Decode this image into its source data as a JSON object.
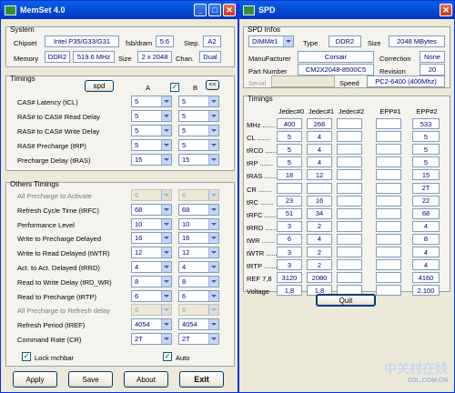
{
  "memset": {
    "title": "MemSet 4.0",
    "system": {
      "legend": "System",
      "chipset_label": "Chipset",
      "chipset_value": "Intel P35/G33/G31",
      "fsb_label": "fsb/dram",
      "fsb_value": "5:6",
      "step_label": "Step.",
      "step_value": "A2",
      "memory_label": "Memory",
      "memory_type": "DDR2",
      "memory_freq": "519.6 MHz",
      "size_label": "Size",
      "size_value": "2 x 2048",
      "chan_label": "Chan.",
      "chan_value": "Dual"
    },
    "timings": {
      "legend": "Timings",
      "spd_button": "spd",
      "col_a": "A",
      "col_b": "B",
      "copy_button": "<<",
      "rows": [
        {
          "label": "CAS# Latency (tCL)",
          "a": "5",
          "b": "5"
        },
        {
          "label": "RAS# to CAS# Read Delay",
          "a": "5",
          "b": "5"
        },
        {
          "label": "RAS# to CAS# Write Delay",
          "a": "5",
          "b": "5"
        },
        {
          "label": "RAS# Precharge (tRP)",
          "a": "5",
          "b": "5"
        },
        {
          "label": "Precharge Delay  (tRAS)",
          "a": "15",
          "b": "15"
        }
      ]
    },
    "others": {
      "legend": "Others Timings",
      "rows": [
        {
          "label": "All Precharge to Activate",
          "a": "6",
          "b": "6"
        },
        {
          "label": "Refresh Cycle Time (tRFC)",
          "a": "68",
          "b": "68"
        },
        {
          "label": "Performance Level",
          "a": "10",
          "b": "10"
        },
        {
          "label": "Write to Precharge Delayed",
          "a": "16",
          "b": "16"
        },
        {
          "label": "Write to Read Delayed (tWTR)",
          "a": "12",
          "b": "12"
        },
        {
          "label": "Act. to Act. Delayed (tRRD)",
          "a": "4",
          "b": "4"
        },
        {
          "label": "Read to Write Delay (tRD_WR)",
          "a": "8",
          "b": "8"
        },
        {
          "label": "Read to Precharge (tRTP)",
          "a": "6",
          "b": "6"
        },
        {
          "label": "All Precharge to Refresh delay",
          "a": "6",
          "b": "6"
        },
        {
          "label": "Refresh Period (tREF)",
          "a": "4054",
          "b": "4054"
        },
        {
          "label": "Command Rate (CR)",
          "a": "2T",
          "b": "2T"
        }
      ],
      "lock_label": "Lock mchbar",
      "auto_label": "Auto"
    },
    "buttons": {
      "apply": "Apply",
      "save": "Save",
      "about": "About",
      "exit": "Exit"
    }
  },
  "spd": {
    "title": "SPD",
    "infos_legend": "SPD Infos",
    "dimm_select": "DIMM#1",
    "type_label": "Type",
    "type_value": "DDR2",
    "size_label": "Size",
    "size_value": "2048 MBytes",
    "manufacturer_label": "ManuFacturer",
    "manufacturer_value": "Corsair",
    "correction_label": "Correction",
    "correction_value": "None",
    "part_label": "Part Number",
    "part_value": "CM2X2048-8500C5",
    "revision_label": "Revision",
    "revision_value": "20",
    "serial_label": "Serial",
    "serial_value": "",
    "speed_label": "Speed",
    "speed_value": "PC2-6400 (400Mhz)",
    "timings_legend": "Timings",
    "columns": [
      "Jedec#0",
      "Jedec#1",
      "Jedec#2",
      "EPP#1",
      "EPP#2"
    ],
    "rows": [
      {
        "label": "MHz .......",
        "v": [
          "400",
          "266",
          "",
          "",
          "533"
        ]
      },
      {
        "label": "CL .......",
        "v": [
          "5",
          "4",
          "",
          "",
          "5"
        ]
      },
      {
        "label": "tRCD .......",
        "v": [
          "5",
          "4",
          "",
          "",
          "5"
        ]
      },
      {
        "label": "tRP .......",
        "v": [
          "5",
          "4",
          "",
          "",
          "5"
        ]
      },
      {
        "label": "tRAS .......",
        "v": [
          "18",
          "12",
          "",
          "",
          "15"
        ]
      },
      {
        "label": "CR .......",
        "v": [
          "",
          "",
          "",
          "",
          "2T"
        ]
      },
      {
        "label": "tRC .......",
        "v": [
          "23",
          "16",
          "",
          "",
          "22"
        ]
      },
      {
        "label": "tRFC .......",
        "v": [
          "51",
          "34",
          "",
          "",
          "68"
        ]
      },
      {
        "label": "tRRD .......",
        "v": [
          "3",
          "2",
          "",
          "",
          "4"
        ]
      },
      {
        "label": "tWR .......",
        "v": [
          "6",
          "4",
          "",
          "",
          "8"
        ]
      },
      {
        "label": "tWTR .......",
        "v": [
          "3",
          "2",
          "",
          "",
          "4"
        ]
      },
      {
        "label": "tRTP .......",
        "v": [
          "3",
          "2",
          "",
          "",
          "4"
        ]
      },
      {
        "label": "REF 7,8",
        "v": [
          "3120",
          "2080",
          "",
          "",
          "4160"
        ]
      },
      {
        "label": "Voltage",
        "v": [
          "1,8",
          "1,8",
          "",
          "",
          "2.100"
        ]
      }
    ],
    "quit": "Quit"
  },
  "watermark": {
    "text": "中关村在线",
    "sub": "ZOL.COM.CN"
  }
}
